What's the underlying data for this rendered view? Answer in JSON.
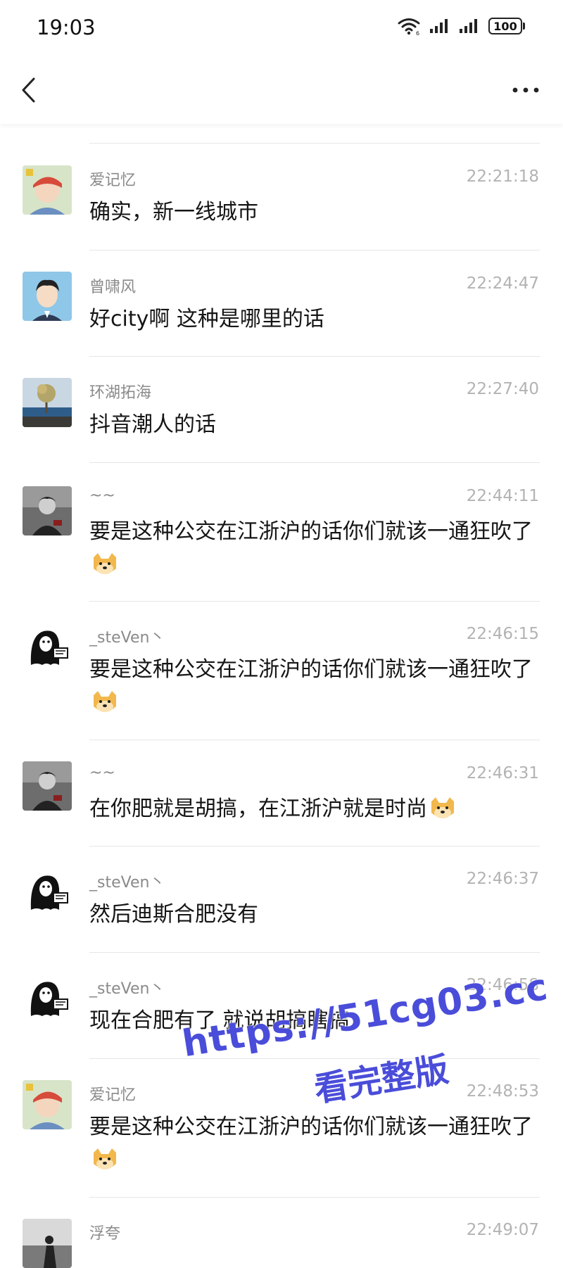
{
  "status_bar": {
    "time": "19:03",
    "battery": "100",
    "icons": [
      "wifi-icon",
      "signal-icon",
      "signal-icon",
      "battery-icon"
    ]
  },
  "top_bar": {
    "back_icon": "chevron-left-icon",
    "more_icon": "more-dots-icon"
  },
  "messages": [
    {
      "name": "爱记忆",
      "time": "22:21:18",
      "text": "确实，新一线城市",
      "emoji": false,
      "avatar": "avatar-aijiyi"
    },
    {
      "name": "曾啸风",
      "time": "22:24:47",
      "text": "好city啊 这种是哪里的话",
      "emoji": false,
      "avatar": "avatar-zengxiaofeng"
    },
    {
      "name": "环湖拓海",
      "time": "22:27:40",
      "text": "抖音潮人的话",
      "emoji": false,
      "avatar": "avatar-huanhu"
    },
    {
      "name": "~~",
      "time": "22:44:11",
      "text": "要是这种公交在江浙沪的话你们就该一通狂吹了",
      "emoji": true,
      "avatar": "avatar-tilde"
    },
    {
      "name": "_steVen丶",
      "time": "22:46:15",
      "text": "要是这种公交在江浙沪的话你们就该一通狂吹了",
      "emoji": true,
      "avatar": "avatar-steven"
    },
    {
      "name": "~~",
      "time": "22:46:31",
      "text": "在你肥就是胡搞，在江浙沪就是时尚",
      "emoji": true,
      "avatar": "avatar-tilde"
    },
    {
      "name": "_steVen丶",
      "time": "22:46:37",
      "text": "然后迪斯合肥没有",
      "emoji": false,
      "avatar": "avatar-steven"
    },
    {
      "name": "_steVen丶",
      "time": "22:46:58",
      "text": "现在合肥有了 就说胡搞瞎搞",
      "emoji": false,
      "avatar": "avatar-steven"
    },
    {
      "name": "爱记忆",
      "time": "22:48:53",
      "text": "要是这种公交在江浙沪的话你们就该一通狂吹了",
      "emoji": true,
      "avatar": "avatar-aijiyi"
    },
    {
      "name": "浮夸",
      "time": "22:49:07",
      "text": "",
      "emoji": false,
      "avatar": "avatar-fukua"
    }
  ],
  "emoji_name": "doge-emoji",
  "watermark": {
    "line1": "https://51cg03.cc",
    "line2": "看完整版",
    "color": "#4a4dd9"
  }
}
